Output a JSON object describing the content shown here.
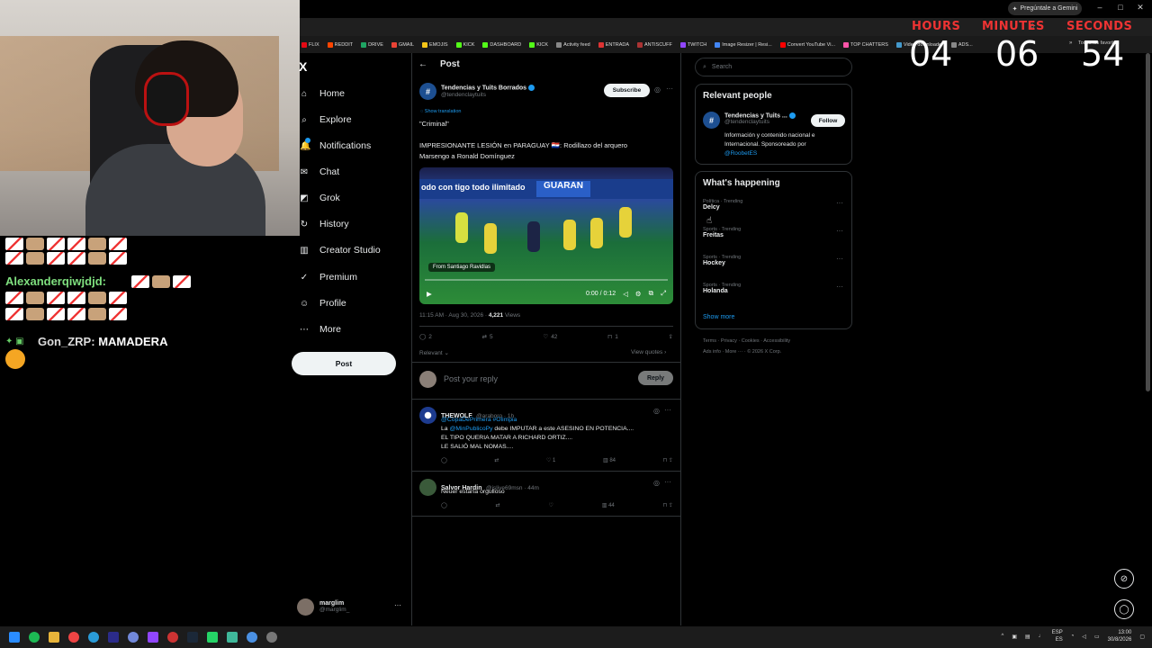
{
  "browser": {
    "gemini_label": "Pregúntale a Gemini",
    "bookmarks": [
      "FLIX",
      "REDDIT",
      "DRIVE",
      "GMAIL",
      "EMOJIS",
      "KICK",
      "DASHBOARD",
      "KICK",
      "Activity feed",
      "ENTRADA",
      "ANTISCUFF",
      "TWITCH",
      "Image Resizer | Resi...",
      "Convert YouTube Vi...",
      "TOP CHATTERS",
      "Video downloader",
      "ADS..."
    ],
    "all_bookmarks": "Todos los favoritos"
  },
  "chat": {
    "line1_user": "Alexanderqiwjdjd:",
    "line2_user": "Gon_ZRP:",
    "line2_msg": "MAMADERA"
  },
  "sidebar": {
    "logo": "X",
    "items": [
      {
        "label": "Home",
        "icon": "⌂"
      },
      {
        "label": "Explore",
        "icon": "⌕"
      },
      {
        "label": "Notifications",
        "icon": "🔔"
      },
      {
        "label": "Chat",
        "icon": "✉"
      },
      {
        "label": "Grok",
        "icon": "◩"
      },
      {
        "label": "History",
        "icon": "↻"
      },
      {
        "label": "Creator Studio",
        "icon": "▥"
      },
      {
        "label": "Premium",
        "icon": "✓"
      },
      {
        "label": "Profile",
        "icon": "☺"
      },
      {
        "label": "More",
        "icon": "⋯"
      }
    ],
    "post_button": "Post",
    "account_name": "marglim",
    "account_handle": "@marglim_"
  },
  "post": {
    "back_icon": "←",
    "header": "Post",
    "avatar_glyph": "#",
    "author": "Tendencias y Tuits Borrados",
    "handle": "@tendenclaytuits",
    "subscribe": "Subscribe",
    "show_translation": "Show translation",
    "quote": "\"Criminal\"",
    "text1": "IMPRESIONANTE LESIÓN en PARAGUAY 🇵🇾: Rodillazo del arquero",
    "text2": "Marsengo a Ronald Domínguez",
    "video_from": "From  Santiago Ravidlas",
    "video_time": "0:00 / 0:12",
    "video_banner": "odo con tigo todo ilimitado",
    "video_banner2": "GUARAN",
    "time": "11:15 AM · Aug 30, 2026 · ",
    "views": "4,221",
    "views_label": " Views",
    "replies": "2",
    "reposts": "5",
    "likes": "42",
    "bookmarks": "1",
    "relevant": "Relevant ⌄",
    "view_quotes": "View quotes ›",
    "reply_placeholder": "Post your reply",
    "reply_button": "Reply"
  },
  "comments": [
    {
      "name": "THEWOLF",
      "handle": "@araboro · 1h",
      "line1_link": "@CopaDePrimera #Olimpia",
      "line2_pre": "La ",
      "line2_link": "@MinPublicoPy",
      "line2_post": " debe IMPUTAR a este ASESINO EN POTENCIA....",
      "line3": "EL TIPO QUERIA MATAR A RICHARD ORTIZ....",
      "line4": "LE SALIÓ MAL NOMAS....",
      "likes": "1",
      "views": "84"
    },
    {
      "name": "Salvor Hardin",
      "handle": "@jslive69msn · 44m",
      "text": "Neuer estaría orgulloso",
      "views": "44"
    }
  ],
  "right": {
    "search_placeholder": "Search",
    "relevant_title": "Relevant people",
    "rp_name": "Tendencias y Tuits ...",
    "rp_handle": "@tendenclaytuits",
    "rp_follow": "Follow",
    "rp_bio1": "Información y contenido nacional e",
    "rp_bio2": "Internacional. Sponsoreado por",
    "rp_bio_link": "@RoobetES",
    "happening_title": "What's happening",
    "trends": [
      {
        "cat": "Política · Trending",
        "name": "Delcy"
      },
      {
        "cat": "Sports · Trending",
        "name": "Freitas"
      },
      {
        "cat": "Sports · Trending",
        "name": "Hockey"
      },
      {
        "cat": "Sports · Trending",
        "name": "Holanda"
      }
    ],
    "show_more": "Show more",
    "footer1": "Terms  ·  Privacy  ·  Cookies  ·  Accessibility",
    "footer2": "Ads info  ·  More ···  ·  © 2026 X Corp."
  },
  "timer": {
    "hours_label": "HOURS",
    "minutes_label": "MINUTES",
    "seconds_label": "SECONDS",
    "hours": "04",
    "minutes": "06",
    "seconds": "54"
  },
  "taskbar": {
    "lang1": "ESP",
    "lang2": "ES",
    "time": "13:00",
    "date": "30/8/2026"
  },
  "colors": {
    "accent": "#1d9bf0",
    "timer_label": "#e33333",
    "bg": "#000000"
  }
}
